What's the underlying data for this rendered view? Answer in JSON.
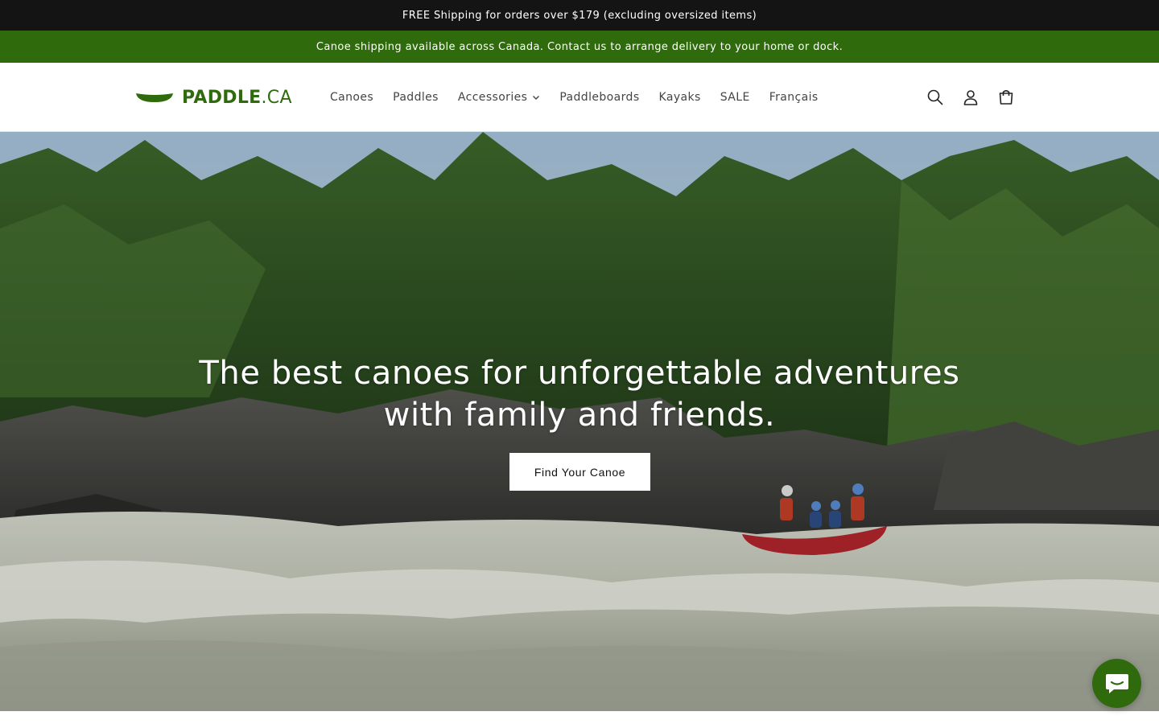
{
  "announcements": {
    "primary": "FREE Shipping for orders over $179 (excluding oversized items)",
    "secondary": "Canoe shipping available across Canada. Contact us to arrange delivery to your home or dock."
  },
  "brand": {
    "name_bold": "PADDLE",
    "name_suffix": ".CA",
    "accent_color": "#2f6a0c"
  },
  "nav": {
    "items": [
      {
        "label": "Canoes"
      },
      {
        "label": "Paddles"
      },
      {
        "label": "Accessories",
        "has_dropdown": true
      },
      {
        "label": "Paddleboards"
      },
      {
        "label": "Kayaks"
      },
      {
        "label": "SALE"
      },
      {
        "label": "Français"
      }
    ]
  },
  "header_icons": [
    "search-icon",
    "account-icon",
    "cart-icon"
  ],
  "hero": {
    "title": "The best canoes for unforgettable adventures with family and friends.",
    "cta_label": "Find Your Canoe"
  },
  "chat": {
    "icon": "chat-icon"
  }
}
